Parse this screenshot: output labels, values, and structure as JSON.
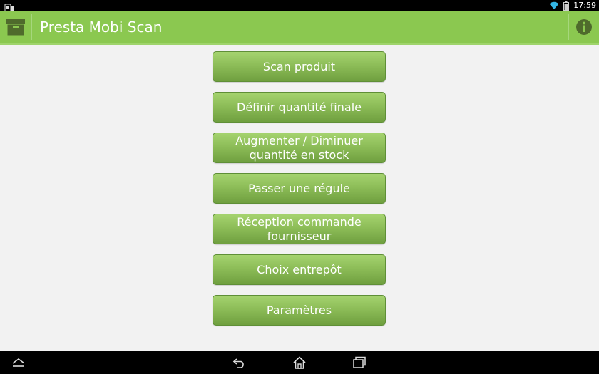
{
  "status_bar": {
    "time": "17:59",
    "icons": [
      "sim-card-icon",
      "wifi-icon",
      "battery-icon"
    ]
  },
  "action_bar": {
    "title": "Presta Mobi Scan",
    "app_icon": "archive-box-icon",
    "info_icon": "info-icon",
    "color": "#8bc850"
  },
  "menu": {
    "buttons": [
      {
        "label": "Scan produit"
      },
      {
        "label": "Définir quantité finale"
      },
      {
        "label": "Augmenter / Diminuer\nquantité en stock"
      },
      {
        "label": "Passer une régule"
      },
      {
        "label": "Réception commande\nfournisseur"
      },
      {
        "label": "Choix entrepôt"
      },
      {
        "label": "Paramètres"
      }
    ]
  },
  "nav_bar": {
    "icons": [
      "hide-keyboard-icon",
      "back-icon",
      "home-icon",
      "recent-apps-icon"
    ]
  }
}
